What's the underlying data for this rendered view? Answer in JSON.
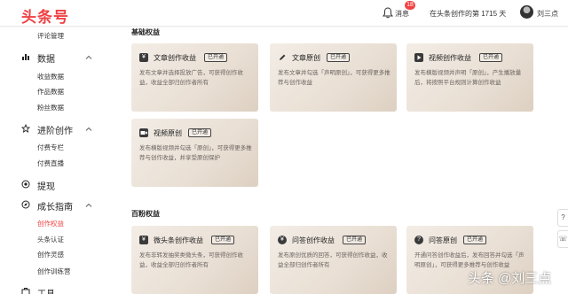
{
  "header": {
    "logo": "头条号",
    "message_badge": "18",
    "message_label": "消息",
    "days_text": "在头条创作的第 1715 天",
    "username": "刘三点"
  },
  "sidebar": {
    "top_item": "评论管理",
    "groups": [
      {
        "label": "数据",
        "icon": "bar-chart-icon",
        "items": [
          "收益数据",
          "作品数据",
          "粉丝数据"
        ]
      },
      {
        "label": "进阶创作",
        "icon": "star-icon",
        "items": [
          "付费专栏",
          "付费直播"
        ]
      },
      {
        "label": "提现",
        "icon": "coin-icon",
        "items": []
      },
      {
        "label": "成长指南",
        "icon": "compass-icon",
        "items": [
          "创作权益",
          "头条认证",
          "创作灵感",
          "创作训练营"
        ],
        "active_item": "创作权益"
      },
      {
        "label": "工具",
        "icon": "tool-icon",
        "items": []
      }
    ]
  },
  "sections": [
    {
      "title": "基础权益",
      "cards": [
        {
          "title": "文章创作收益",
          "badge": "已开通",
          "icon": "yuan-icon",
          "desc": "发布文章并选择投放广告，可获得创作收益，收益全部归创作者所有"
        },
        {
          "title": "文章原创",
          "badge": "已开通",
          "icon": "pen-icon",
          "desc": "发布文章并勾选「声明原创」，可获得更多推荐与创作收益"
        },
        {
          "title": "视频创作收益",
          "badge": "已开通",
          "icon": "video-icon",
          "desc": "发布横版视频并声明「原创」，产生播放量后，将按照平台规则计算创作收益"
        },
        {
          "title": "视频原创",
          "badge": "已开通",
          "icon": "video-original-icon",
          "desc": "发布横版视频并勾选「原创」，可获得更多推荐与创作收益，并享受原创保护"
        }
      ]
    },
    {
      "title": "百粉权益",
      "cards": [
        {
          "title": "微头条创作收益",
          "badge": "已开通",
          "icon": "yuan-icon",
          "desc": "发布非转发抽奖类微头条，可获得创作收益，收益全部归创作者所有"
        },
        {
          "title": "问答创作收益",
          "badge": "已开通",
          "icon": "yuan-icon",
          "desc": "发布原创优质的回答，可获得创作收益，收益全部归创作者所有"
        },
        {
          "title": "问答原创",
          "badge": "已开通",
          "icon": "question-icon",
          "desc": "开通问答创作收益后，发布回答并勾选「声明原创」，可获得更多推荐与创作收益"
        }
      ]
    }
  ],
  "watermark": "头条 @刘三点",
  "colors": {
    "brand": "#f04142",
    "card_start": "#f3ede6",
    "card_end": "#ddd0c2"
  }
}
